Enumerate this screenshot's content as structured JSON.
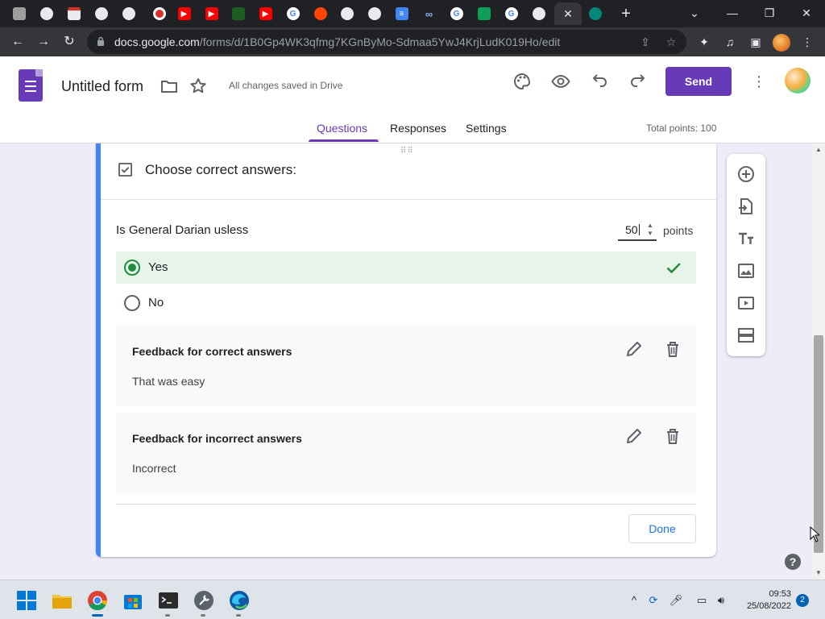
{
  "browser": {
    "address_host": "docs.google.com",
    "address_path": "/forms/d/1B0Gp4WK3qfmg7KGnByMo-Sdmaa5YwJ4KrjLudK019Ho/edit",
    "tab_favicons": [
      "app-icon",
      "chrome-icon",
      "calendar-icon",
      "chrome-icon",
      "chrome-icon",
      "record-icon",
      "youtube-icon",
      "youtube-icon",
      "app-icon",
      "youtube-icon",
      "google-icon",
      "reddit-icon",
      "chrome-icon",
      "chrome-icon",
      "docs-icon",
      "link-icon",
      "google-icon",
      "chat-icon",
      "google-icon",
      "chrome-icon",
      "chrome-icon",
      "hangouts-icon"
    ]
  },
  "form": {
    "title": "Untitled form",
    "save_status": "All changes saved in Drive",
    "send_label": "Send",
    "tabs": [
      {
        "label": "Questions",
        "active": true
      },
      {
        "label": "Responses",
        "active": false
      },
      {
        "label": "Settings",
        "active": false
      }
    ],
    "total_points": "Total points: 100"
  },
  "answer_key": {
    "heading": "Choose correct answers:",
    "question": "Is General Darian usless",
    "points_value": "50",
    "points_label": "points",
    "options": [
      {
        "label": "Yes",
        "correct": true
      },
      {
        "label": "No",
        "correct": false
      }
    ],
    "feedback_correct": {
      "title": "Feedback for correct answers",
      "text": "That was easy"
    },
    "feedback_incorrect": {
      "title": "Feedback for incorrect answers",
      "text": "Incorrect"
    },
    "done_label": "Done"
  },
  "taskbar": {
    "time": "09:53",
    "date": "25/08/2022",
    "notification_count": "2"
  },
  "colors": {
    "accent": "#673ab7",
    "correct": "#1e8e3e",
    "card_accent": "#4285f4",
    "link": "#1a73e8"
  }
}
